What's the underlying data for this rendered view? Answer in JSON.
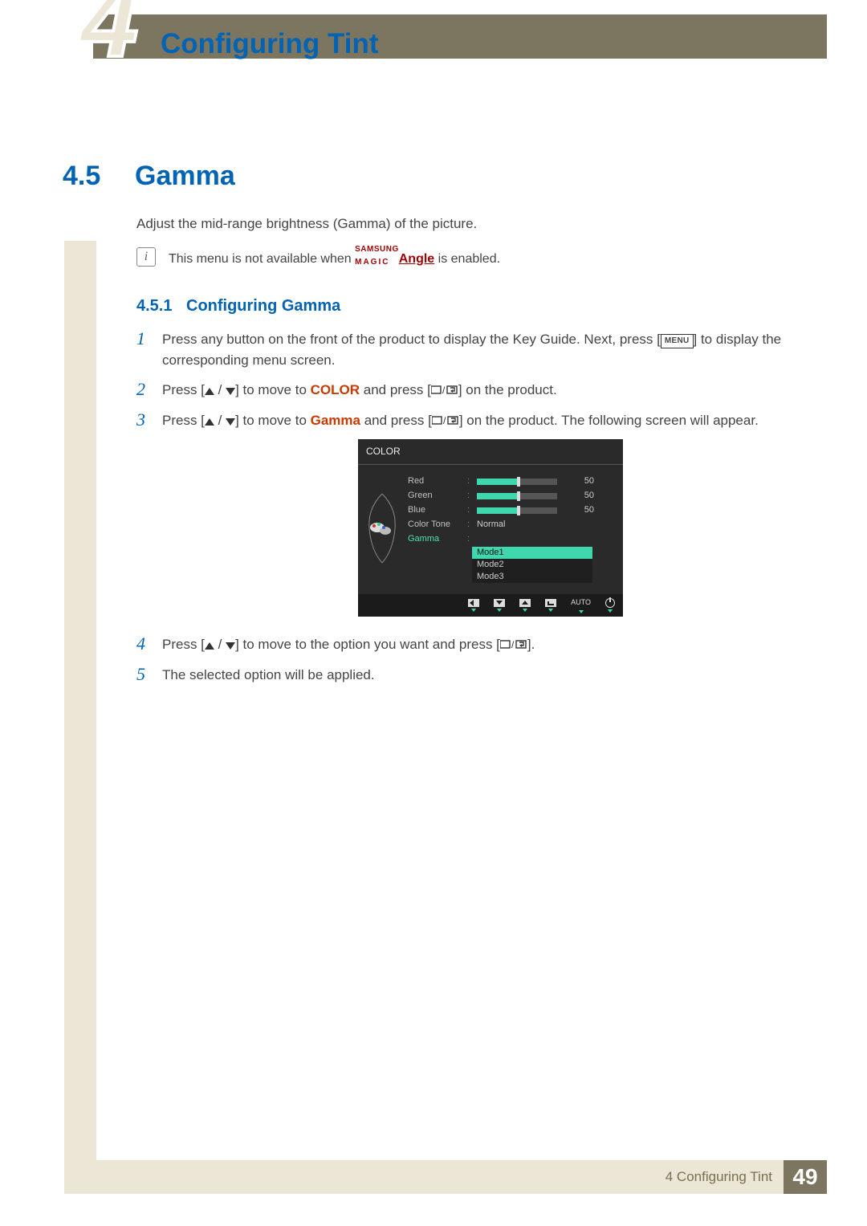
{
  "header": {
    "chapter_tab_number": "4",
    "chapter_title": "Configuring Tint"
  },
  "section": {
    "number": "4.5",
    "title": "Gamma",
    "intro": "Adjust the mid-range brightness (Gamma) of the picture."
  },
  "note": {
    "prefix": "This menu is not available when ",
    "brand_top": "SAMSUNG",
    "brand_bottom": "MAGIC",
    "brand_word": "Angle",
    "suffix": " is enabled."
  },
  "subsection": {
    "number": "4.5.1",
    "title": "Configuring Gamma"
  },
  "steps": {
    "s1": {
      "num": "1",
      "a": "Press any button on the front of the product to display the Key Guide. Next, press [",
      "menu": "MENU",
      "b": "] to display the corresponding menu screen."
    },
    "s2": {
      "num": "2",
      "a": "Press [",
      "b": "] to move to ",
      "kw": "COLOR",
      "c": " and press [",
      "d": "] on the product."
    },
    "s3": {
      "num": "3",
      "a": "Press [",
      "b": "] to move to ",
      "kw": "Gamma",
      "c": " and press [",
      "d": "] on the product. The following screen will appear."
    },
    "s4": {
      "num": "4",
      "a": "Press [",
      "b": "] to move to the option you want and press [",
      "c": "]."
    },
    "s5": {
      "num": "5",
      "text": "The selected option will be applied."
    }
  },
  "osd": {
    "title": "COLOR",
    "rows": {
      "red": {
        "label": "Red",
        "value_text": "50",
        "value_pct": 50
      },
      "green": {
        "label": "Green",
        "value_text": "50",
        "value_pct": 50
      },
      "blue": {
        "label": "Blue",
        "value_text": "50",
        "value_pct": 50
      },
      "tone": {
        "label": "Color Tone",
        "value_text": "Normal"
      },
      "gamma": {
        "label": "Gamma"
      }
    },
    "gamma_options": {
      "m1": "Mode1",
      "m2": "Mode2",
      "m3": "Mode3"
    },
    "selected_option": "m1",
    "footer_auto": "AUTO"
  },
  "footer": {
    "chapter_label": "4 Configuring Tint",
    "page_number": "49"
  }
}
